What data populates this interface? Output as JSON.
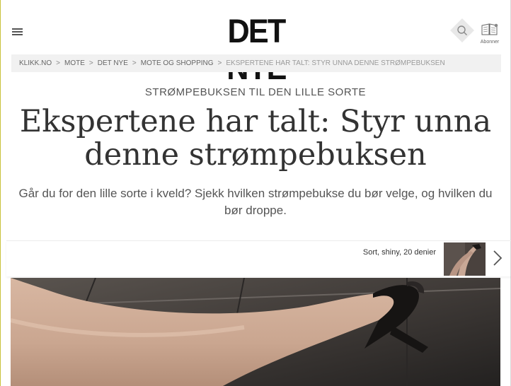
{
  "header": {
    "logo": "DET NYE",
    "subscribe_label": "Abonner"
  },
  "breadcrumb": {
    "items": [
      "KLIKK.NO",
      "MOTE",
      "DET NYE",
      "MOTE OG SHOPPING"
    ],
    "separator": ">",
    "current": "EKSPERTENE HAR TALT: STYR UNNA DENNE STRØMPEBUKSEN"
  },
  "article": {
    "kicker": "STRØMPEBUKSEN TIL DEN LILLE SORTE",
    "headline": "Ekspertene har talt: Styr unna denne strømpebuksen",
    "lede": "Går du for den lille sorte i kveld? Sjekk hvilken strømpebukse du bør velge, og hvilken du bør droppe."
  },
  "gallery": {
    "next_caption": "Sort, shiny, 20 denier"
  },
  "colors": {
    "breadcrumb_bg": "#f1f1f1",
    "text": "#333333",
    "search_bg": "#e8e8e8"
  },
  "icons": [
    "hamburger-menu-icon",
    "search-icon",
    "magazine-icon",
    "chevron-right-icon"
  ]
}
